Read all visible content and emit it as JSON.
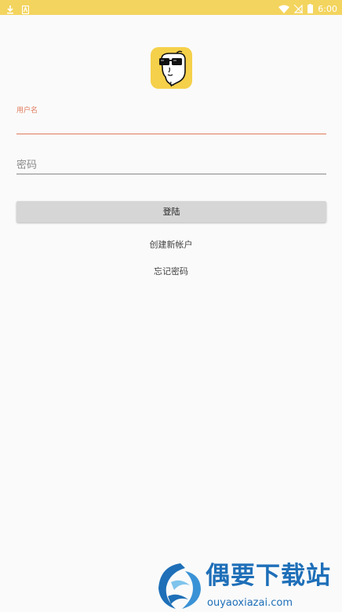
{
  "status_bar": {
    "time": "6:00",
    "left_icons": [
      "download-icon",
      "notification-icon"
    ],
    "right_icons": [
      "wifi-icon",
      "no-sim-icon",
      "battery-icon"
    ],
    "color": "#f3d45e"
  },
  "logo": {
    "icon": "glasses-character-logo",
    "background": "#f5d04a"
  },
  "login_form": {
    "username_label": "用户名",
    "username_value": "",
    "password_placeholder": "密码",
    "login_label": "登陆"
  },
  "links": {
    "create_account": "创建新帐户",
    "forgot_password": "忘记密码"
  },
  "watermark": {
    "title": "偶要下载站",
    "url": "ouyaoxiazai.com"
  },
  "colors": {
    "accent": "#e07c5e",
    "button": "#d6d6d6",
    "watermark": "#1e6fb8"
  }
}
